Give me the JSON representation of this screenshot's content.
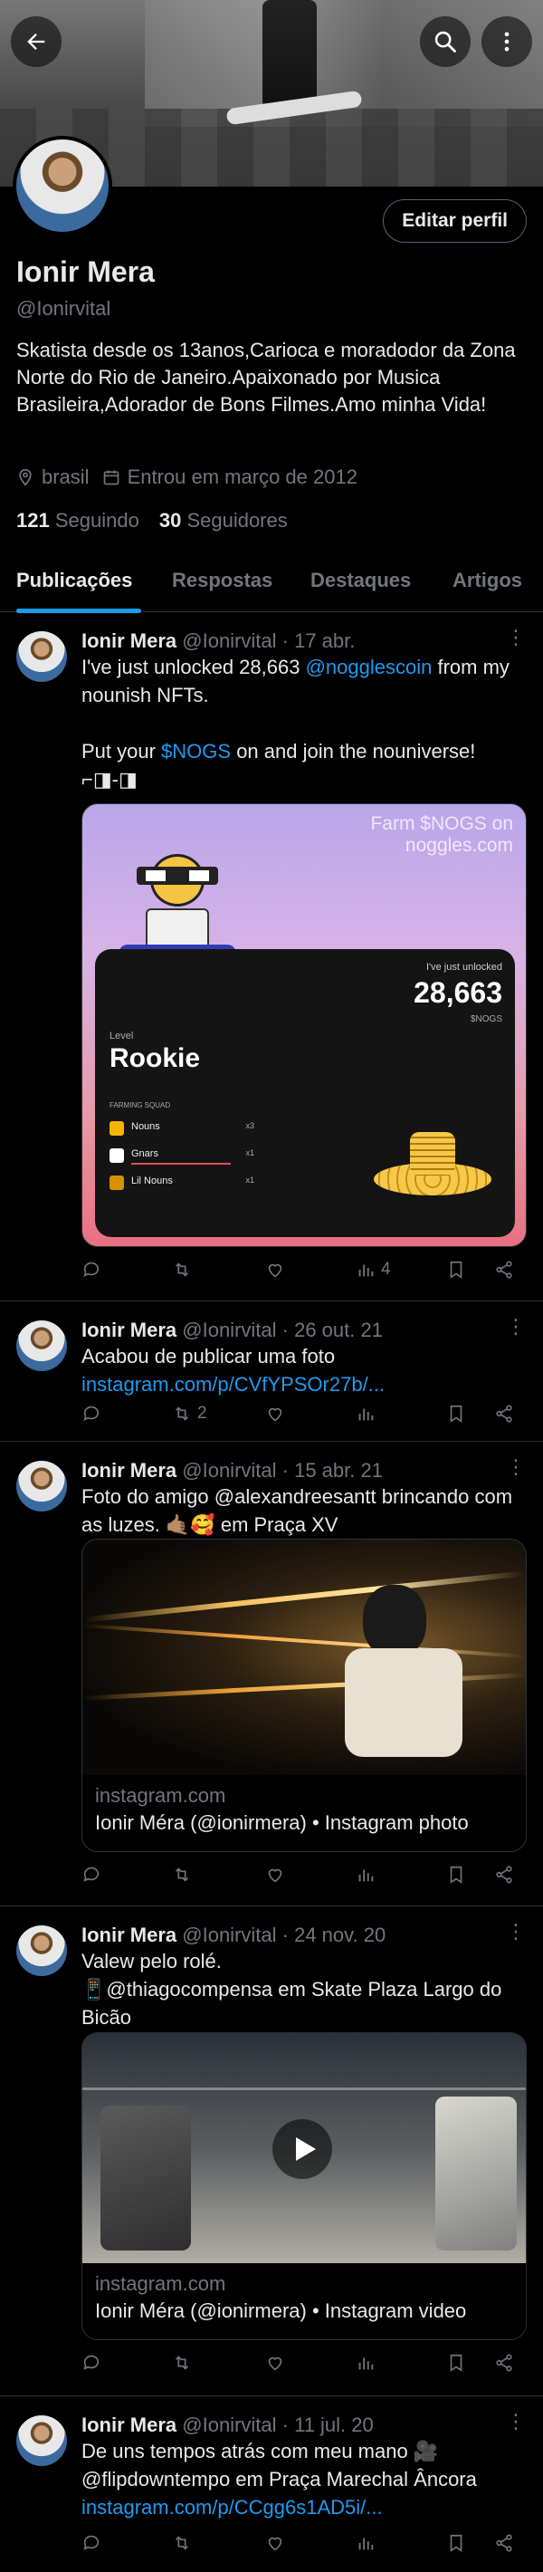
{
  "header": {
    "back_icon": "arrow-left-icon",
    "search_icon": "search-icon",
    "more_icon": "more-vertical-icon",
    "edit_label": "Editar perfil"
  },
  "profile": {
    "name": "Ionir Mera",
    "handle": "@Ionirvital",
    "bio": "Skatista desde os 13anos,Carioca e moradodor da Zona Norte do Rio de Janeiro.Apaixonado  por Musica Brasileira,Adorador de Bons Filmes.Amo minha Vida!",
    "location": "brasil",
    "joined": "Entrou em março de 2012",
    "following_count": "121",
    "following_label": "Seguindo",
    "followers_count": "30",
    "followers_label": "Seguidores"
  },
  "tabs": [
    {
      "label": "Publicações",
      "active": true
    },
    {
      "label": "Respostas",
      "active": false
    },
    {
      "label": "Destaques",
      "active": false
    },
    {
      "label": "Artigos",
      "active": false
    }
  ],
  "tweets": [
    {
      "name": "Ionir Mera",
      "handle": "@Ionirvital",
      "date": "· 17 abr.",
      "text_1": "I've just unlocked 28,663 ",
      "mention_1": "@nogglescoin",
      "text_2": " from my nounish NFTs.",
      "text_3": "Put your ",
      "cashtag": "$NOGS",
      "text_4": " on and join the nouniverse!",
      "text_5": "⌐◨-◨",
      "card": {
        "farm_line_1": "Farm $NOGS on",
        "farm_line_2": "noggles.com",
        "unlocked_label": "I've just unlocked",
        "unlocked_value": "28,663",
        "unit": "$NOGS",
        "level_label": "Level",
        "level_value": "Rookie",
        "squad_label": "FARMING SQUAD",
        "squad": [
          {
            "name": "Nouns",
            "mult": "x3"
          },
          {
            "name": "Gnars",
            "mult": "x1"
          },
          {
            "name": "Lil Nouns",
            "mult": "x1"
          }
        ]
      },
      "views": "4",
      "retweets": "",
      "likes": ""
    },
    {
      "name": "Ionir Mera",
      "handle": "@Ionirvital",
      "date": "· 26 out. 21",
      "text_1": "Acabou de publicar uma foto ",
      "link": "instagram.com/p/CVfYPSOr27b/...",
      "retweets": "2"
    },
    {
      "name": "Ionir Mera",
      "handle": "@Ionirvital",
      "date": "· 15 abr. 21",
      "text_1": "Foto do amigo @alexandreesantt brincando com as luzes. 🤙🏽🥰 em Praça XV",
      "card_domain": "instagram.com",
      "card_title": "Ionir Méra (@ionirmera) • Instagram photo"
    },
    {
      "name": "Ionir Mera",
      "handle": "@Ionirvital",
      "date": "· 24 nov. 20",
      "text_1": "Valew pelo rolé.",
      "text_2": "📱@thiagocompensa em Skate Plaza Largo do Bicão",
      "card_domain": "instagram.com",
      "card_title": "Ionir Méra (@ionirmera) • Instagram video"
    },
    {
      "name": "Ionir Mera",
      "handle": "@Ionirvital",
      "date": "· 11 jul. 20",
      "text_1": "De uns tempos atrás com meu mano 🎥",
      "text_2": "@flipdowntempo em Praça Marechal Âncora",
      "link": "instagram.com/p/CCgg6s1AD5i/..."
    }
  ],
  "colors": {
    "accent": "#1d9bf0",
    "muted": "#71767b",
    "background": "#000000",
    "text": "#e7e9ea"
  }
}
